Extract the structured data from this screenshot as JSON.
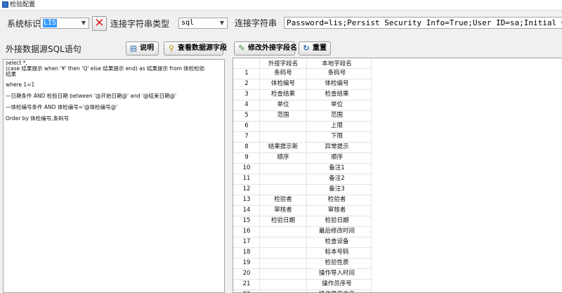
{
  "window": {
    "title": "检验配置"
  },
  "toolbar": {
    "system_label": "系统标识",
    "system_value": "LIS",
    "conn_type_label": "连接字符串类型",
    "conn_type_value": "sql",
    "conn_string_label": "连接字符串",
    "conn_string_value": "Password=lis;Persist Security Info=True;User ID=sa;Initial Catalog=HOS"
  },
  "left": {
    "section_label": "外接数据源SQL语句",
    "help_button": "说明",
    "view_fields_button": "查看数据源字段",
    "sql_lines": [
      "select *,",
      "(case 结果提示 when '¥'   then 'Q' else 结果提示 end) as 结果提示 from 体检检验",
      "结果",
      "",
      "where 1=1",
      "",
      "—日期条件 AND 检验日期 between '@开始日期@' and '@结束日期@'",
      "",
      "—体检编号条件 AND 体检编号='@体检编号@'",
      "",
      "Order by 体检编号,条码号"
    ]
  },
  "right": {
    "edit_fields_button": "修改外接字段名",
    "reset_button": "重置",
    "grid": {
      "headers": [
        "",
        "外接字段名",
        "本地字段名"
      ],
      "rows": [
        [
          "1",
          "条码号",
          "条码号"
        ],
        [
          "2",
          "体检编号",
          "体检编号"
        ],
        [
          "3",
          "检查结果",
          "检查结果"
        ],
        [
          "4",
          "单位",
          "单位"
        ],
        [
          "5",
          "范围",
          "范围"
        ],
        [
          "6",
          "",
          "上限"
        ],
        [
          "7",
          "",
          "下限"
        ],
        [
          "8",
          "结果提示新",
          "异常提示"
        ],
        [
          "9",
          "顺序",
          "顺序"
        ],
        [
          "10",
          "",
          "备注1"
        ],
        [
          "11",
          "",
          "备注2"
        ],
        [
          "12",
          "",
          "备注3"
        ],
        [
          "13",
          "检验者",
          "检验者"
        ],
        [
          "14",
          "审核者",
          "审核者"
        ],
        [
          "15",
          "检验日期",
          "检验日期"
        ],
        [
          "16",
          "",
          "最后修改时间"
        ],
        [
          "17",
          "",
          "检查设备"
        ],
        [
          "18",
          "",
          "标本号码"
        ],
        [
          "19",
          "",
          "检验性质"
        ],
        [
          "20",
          "",
          "操作导入时间"
        ],
        [
          "21",
          "",
          "操作员序号"
        ],
        [
          "22",
          "",
          "操作员用户名"
        ]
      ]
    }
  },
  "colors": {
    "selection": "#3399ff",
    "delete_icon": "#e02020",
    "window_bg": "#f0f0f0"
  }
}
